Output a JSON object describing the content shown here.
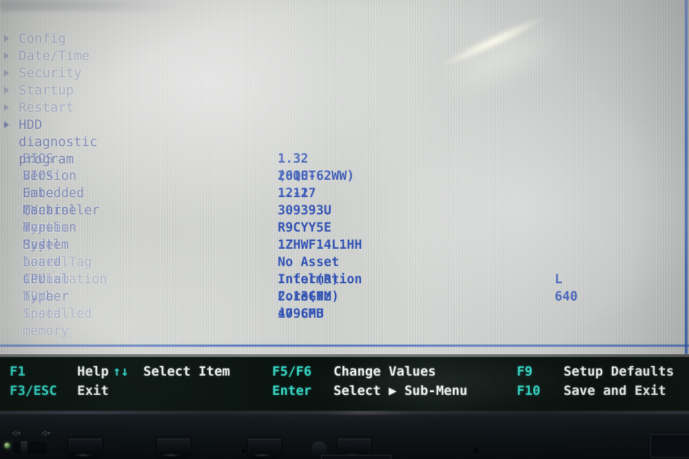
{
  "screen": {
    "menu": {
      "items": [
        {
          "label": "Config",
          "arrow": "▸"
        },
        {
          "label": "Date/Time",
          "arrow": "▸"
        },
        {
          "label": "Security",
          "arrow": "▸"
        },
        {
          "label": "Startup",
          "arrow": "▸"
        },
        {
          "label": "Restart",
          "arrow": "▸"
        },
        {
          "label": "HDD diagnostic program",
          "arrow": "▸"
        }
      ]
    },
    "info": {
      "rows": [
        {
          "label": "BIOS Version",
          "value": "1.32   (6QET62WW)"
        },
        {
          "label": "BIOS Date (Year-Month-Day)",
          "value": "2010-12-17"
        },
        {
          "label": "Embedded Controller Version",
          "value": "1.12"
        },
        {
          "label": "Machine Type Model",
          "value": "309393U"
        },
        {
          "label": "System-unit serial number",
          "value": "R9CYY5E"
        },
        {
          "label": "System board serial number",
          "value": "1ZHWF14L1HH"
        },
        {
          "label": "Asset Tag information",
          "value": "No Asset Information"
        },
        {
          "label": "CPU Type",
          "value": "Intel(R) Core(TM) i7 CPU",
          "value2": "L 640"
        },
        {
          "label": "CPU Speed",
          "value": "2.13GHz"
        },
        {
          "label": "Installed memory",
          "value": "4096MB"
        }
      ]
    }
  },
  "footer": {
    "entries": [
      {
        "key": "F1",
        "desc": "Help",
        "glyph": "↑↓"
      },
      {
        "key": "",
        "desc": "Select Item"
      },
      {
        "key": "F3/ESC",
        "desc": "Exit"
      },
      {
        "key": "F5/F6",
        "desc": "Change Values"
      },
      {
        "key": "Enter",
        "desc": "Select ▶ Sub-Menu"
      },
      {
        "key": "F9",
        "desc": "Setup Defaults"
      },
      {
        "key": "F10",
        "desc": "Save and Exit"
      }
    ]
  },
  "bezel": {
    "volume_icon_left": "◁«",
    "volume_icon_right": "◁»"
  },
  "colors": {
    "screen_bg": "#d3d5d2",
    "menu_text": "#6874 9e",
    "label_text": "#5666a4",
    "value_text": "#2f51b5",
    "footer_bg": "#0d1512",
    "footer_key": "#35d6c4",
    "footer_desc": "#eef2f0",
    "rule": "#3f65bb"
  }
}
